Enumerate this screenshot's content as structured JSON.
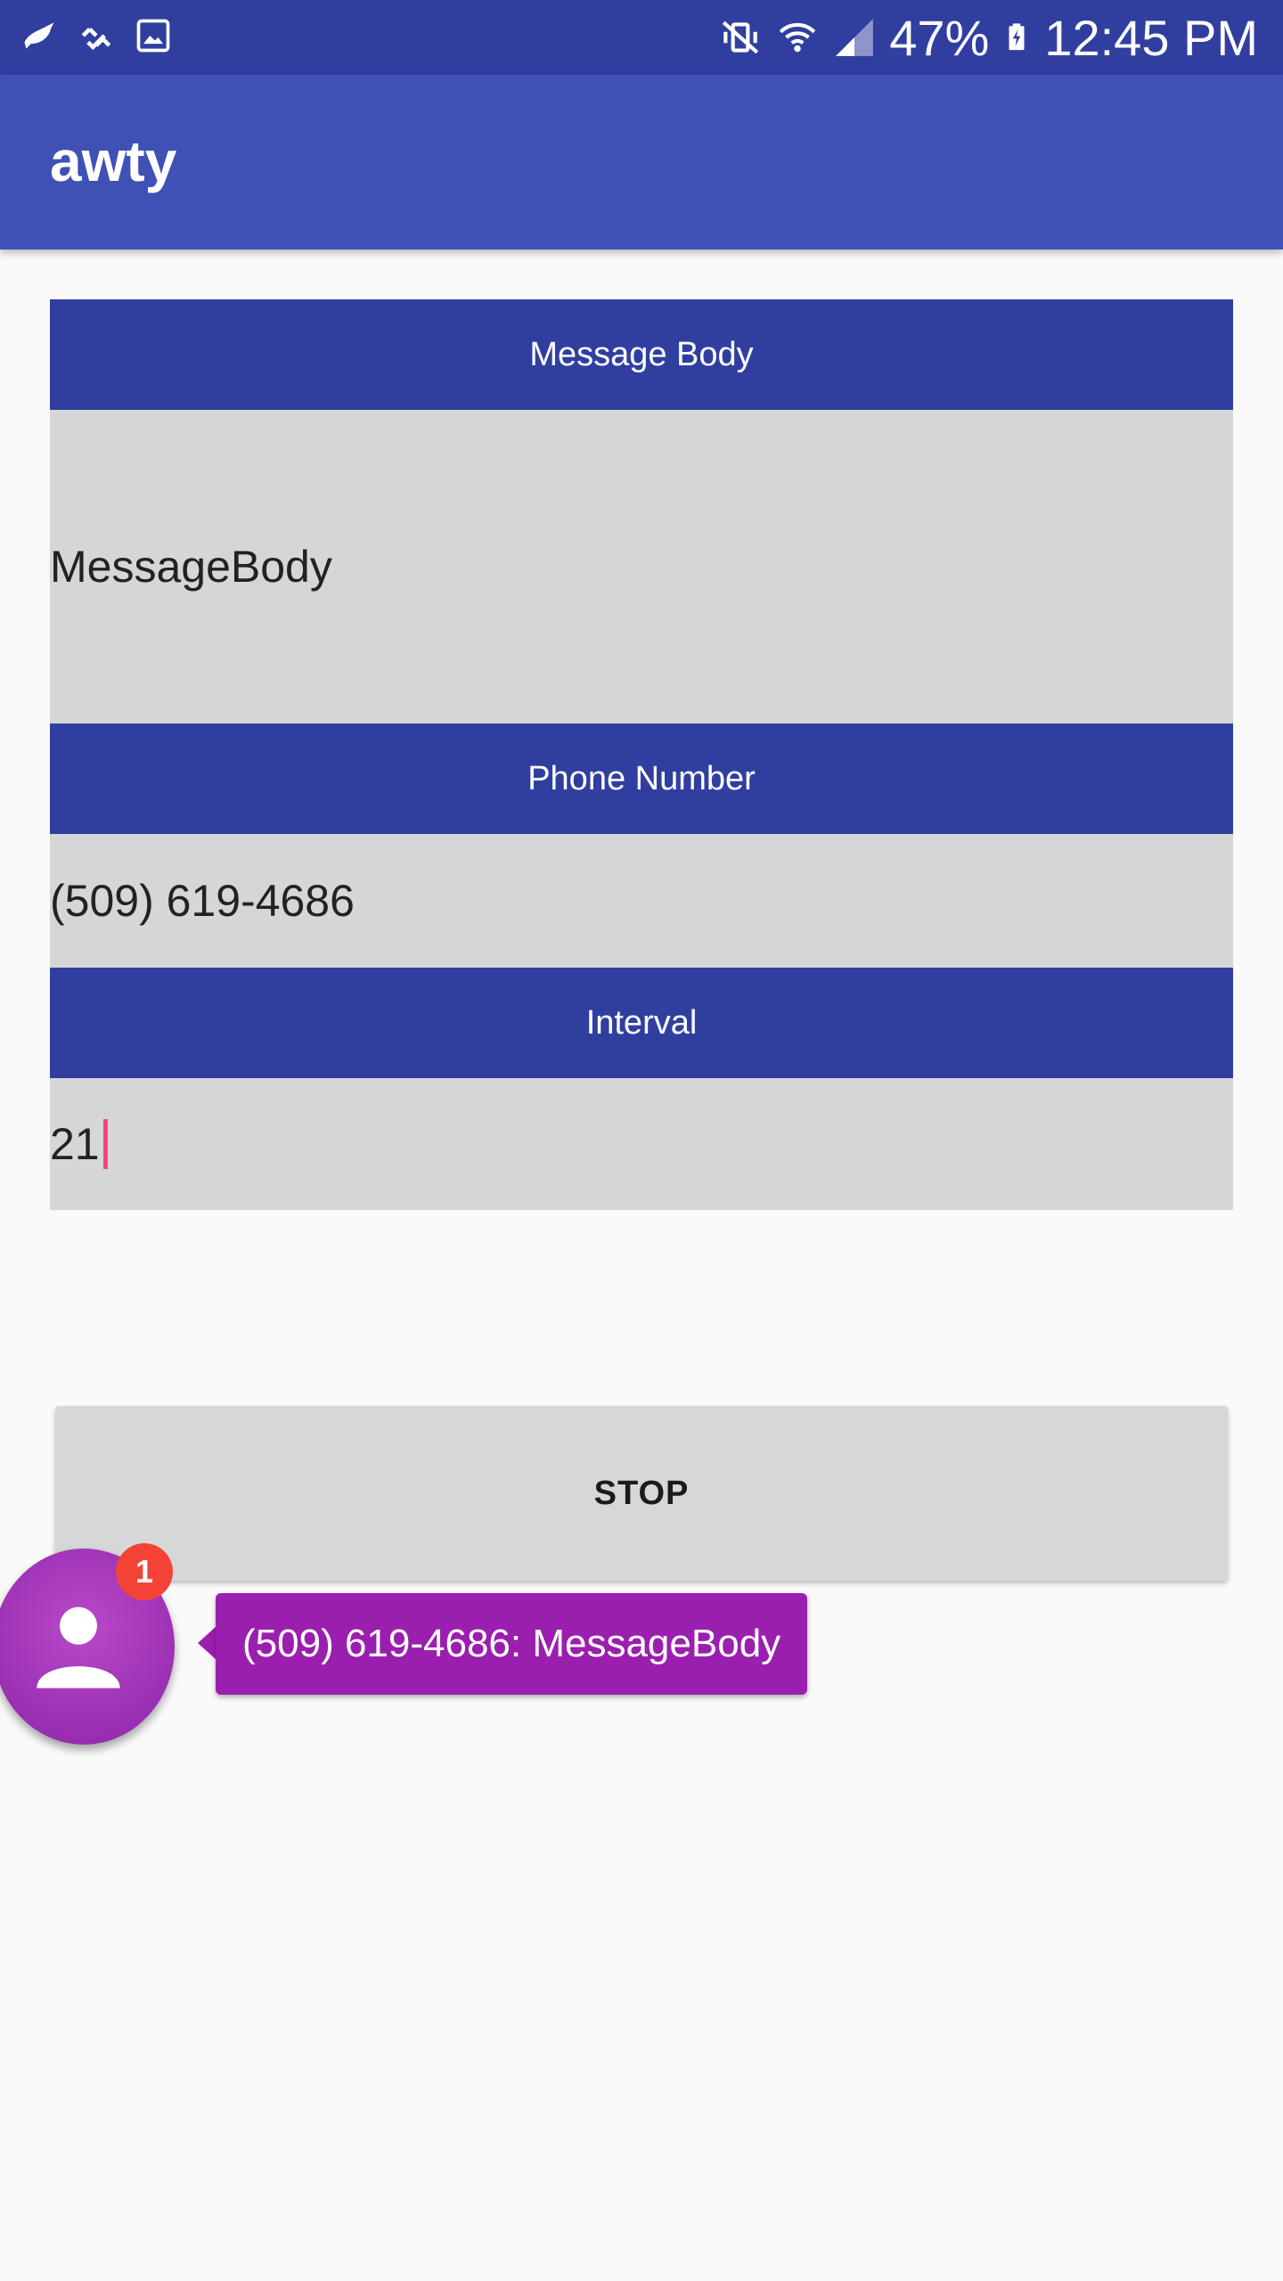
{
  "status_bar": {
    "battery": "47%",
    "time": "12:45 PM",
    "icons_left": [
      "bird-icon",
      "sync-check-icon",
      "image-icon"
    ],
    "icons_right": [
      "mute-vibrate-icon",
      "wifi-icon",
      "cell-signal-icon",
      "battery-charging-icon"
    ]
  },
  "app_bar": {
    "title": "awty"
  },
  "form": {
    "message_label": "Message Body",
    "message_value": "MessageBody",
    "phone_label": "Phone Number",
    "phone_value": "(509) 619-4686",
    "interval_label": "Interval",
    "interval_value": "21"
  },
  "stop_button": {
    "label": "STOP"
  },
  "chat_head": {
    "badge_count": "1",
    "message": "(509) 619-4686: MessageBody",
    "icon": "person-icon"
  },
  "colors": {
    "primary": "#3f51b5",
    "primary_dark": "#303f9f",
    "accent": "#ff4081",
    "chat_head": "#9b1fae",
    "badge": "#f44336"
  }
}
